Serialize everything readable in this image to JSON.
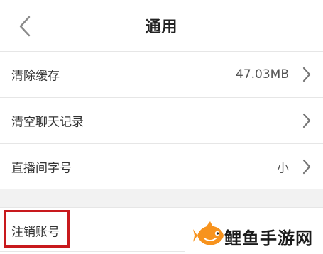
{
  "header": {
    "title": "通用"
  },
  "settings": {
    "items": [
      {
        "label": "清除缓存",
        "value": "47.03MB"
      },
      {
        "label": "清空聊天记录",
        "value": ""
      },
      {
        "label": "直播间字号",
        "value": "小"
      }
    ],
    "cancel_account": {
      "label": "注销账号"
    }
  },
  "watermark": {
    "text": "鲤鱼手游网"
  },
  "colors": {
    "highlight_border": "#c8191d",
    "section_gap": "#f2f2f2",
    "fish_orange": "#f7931e"
  },
  "icons": {
    "back": "chevron-left-icon",
    "row_arrow": "chevron-right-icon",
    "logo": "fish-logo-icon"
  }
}
